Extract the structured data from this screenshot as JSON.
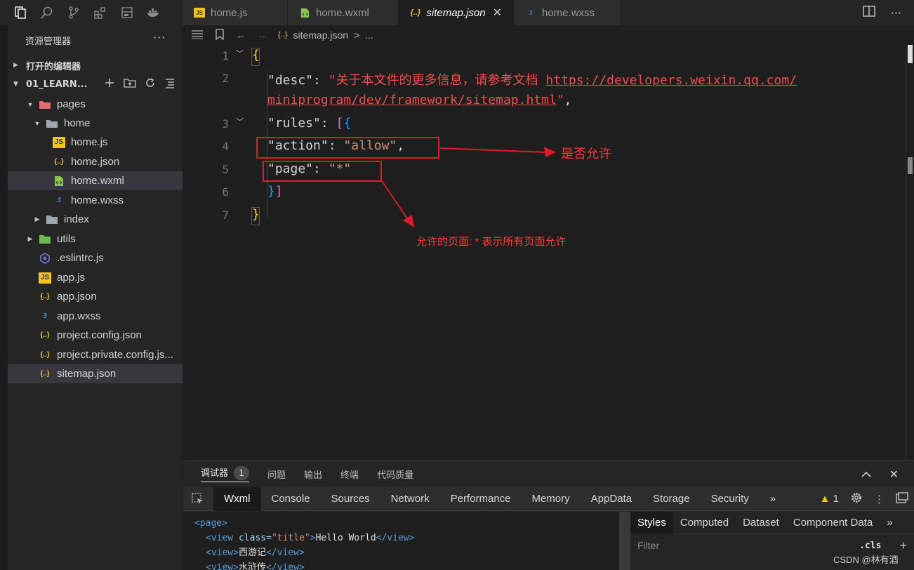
{
  "sidebar": {
    "title": "资源管理器",
    "more": "···",
    "open_editors": "打开的编辑器",
    "project": "01_LEARN...",
    "tree": [
      {
        "label": "pages"
      },
      {
        "label": "home"
      },
      {
        "label": "home.js"
      },
      {
        "label": "home.json"
      },
      {
        "label": "home.wxml"
      },
      {
        "label": "home.wxss"
      },
      {
        "label": "index"
      },
      {
        "label": "utils"
      },
      {
        "label": ".eslintrc.js"
      },
      {
        "label": "app.js"
      },
      {
        "label": "app.json"
      },
      {
        "label": "app.wxss"
      },
      {
        "label": "project.config.json"
      },
      {
        "label": "project.private.config.js..."
      },
      {
        "label": "sitemap.json"
      }
    ]
  },
  "tabs": [
    {
      "label": "home.js",
      "icon": "JS"
    },
    {
      "label": "home.wxml",
      "icon": "wxml"
    },
    {
      "label": "sitemap.json",
      "icon": "{..}"
    },
    {
      "label": "home.wxss",
      "icon": "wxss"
    }
  ],
  "breadcrumb": {
    "file": "sitemap.json",
    "sep": ">",
    "more": "..."
  },
  "editor": {
    "line_numbers": [
      "1",
      "2",
      "3",
      "4",
      "5",
      "6",
      "7"
    ],
    "code": {
      "desc_key": "\"desc\"",
      "desc_value": "\"关于本文件的更多信息，请参考文档 ",
      "url_part1": "https://developers.weixin.qq.com/",
      "url_part2": "miniprogram/dev/framework/sitemap.html",
      "rules_key": "\"rules\"",
      "action_key": "\"action\"",
      "action_value": "\"allow\"",
      "page_key": "\"page\"",
      "page_value": "\"*\""
    }
  },
  "annotations": {
    "allow": "是否允许",
    "page": "允许的页面: * 表示所有页面允许"
  },
  "debugger": {
    "tabs": [
      "调试器",
      "问题",
      "输出",
      "终端",
      "代码质量"
    ],
    "badge": "1",
    "devtools_tabs": [
      "Wxml",
      "Console",
      "Sources",
      "Network",
      "Performance",
      "Memory",
      "AppData",
      "Storage",
      "Security"
    ],
    "more": "»",
    "warning_count": "1",
    "wxml_lines": {
      "l1_tag": "<page>",
      "l2_open": "<view",
      "l2_attr": " class=",
      "l2_val": "\"title\"",
      "l2_gt": ">",
      "l2_text": "Hello World",
      "l2_close": "</view>",
      "l3_open": "<view>",
      "l3_text": "西游记",
      "l3_close": "</view>",
      "l4_open": "<view>",
      "l4_text": "水浒传",
      "l4_close": "</view>"
    },
    "styles_tabs": [
      "Styles",
      "Computed",
      "Dataset",
      "Component Data"
    ],
    "filter_placeholder": "Filter",
    "cls": ".cls",
    "plus": "+"
  },
  "watermark": "CSDN @林有酒",
  "colors": {
    "annotation_red": "#e0192b",
    "accent": "#007acc"
  }
}
